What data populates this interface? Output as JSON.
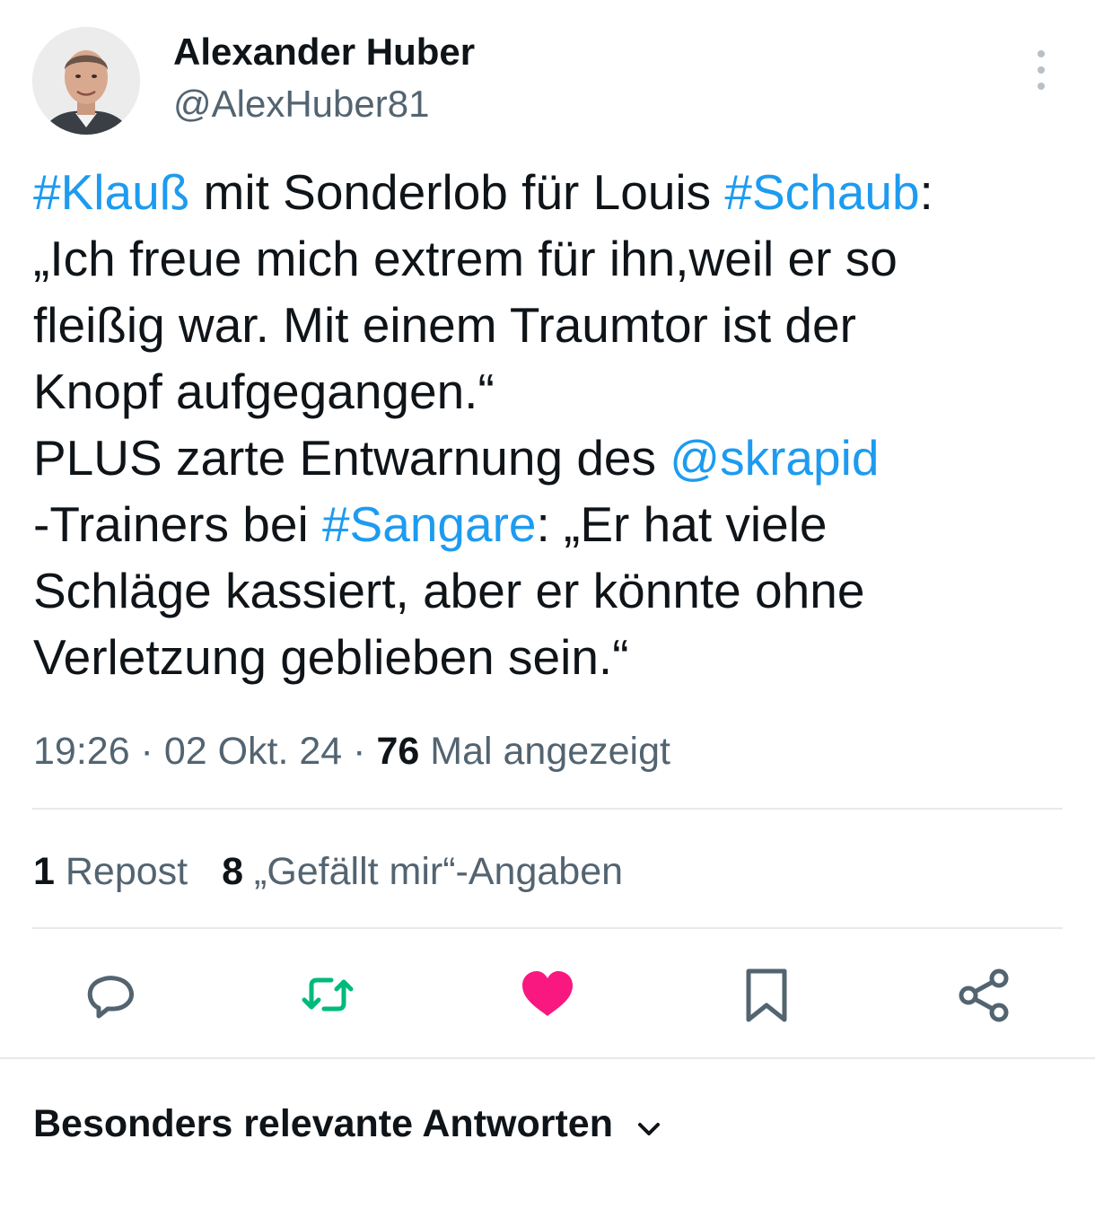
{
  "author": {
    "name": "Alexander Huber",
    "handle": "@AlexHuber81"
  },
  "tweet": {
    "line1": {
      "tag1": "#Klauß",
      "text1": " mit Sonderlob für Louis ",
      "tag2": "#Schaub",
      "text2": ":"
    },
    "line2": "„Ich freue mich extrem für ihn,weil er so",
    "line3": "fleißig war. Mit einem Traumtor ist der",
    "line4": "Knopf aufgegangen.“",
    "line5": {
      "text": "PLUS zarte Entwarnung des ",
      "mention": "@skrapid"
    },
    "line6": {
      "text1": "-Trainers bei ",
      "tag": "#Sangare",
      "text2": ": „Er hat viele"
    },
    "line7": "Schläge kassiert, aber er könnte ohne",
    "line8": "Verletzung geblieben sein.“"
  },
  "meta": {
    "time": "19:26",
    "date": "02 Okt. 24",
    "views_count": "76",
    "views_label": "Mal angezeigt",
    "separator": " · "
  },
  "stats": {
    "reposts_count": "1",
    "reposts_label": "Repost",
    "likes_count": "8",
    "likes_label": "„Gefällt mir“-Angaben"
  },
  "actions": {
    "icons": [
      "reply-icon",
      "repost-icon",
      "like-icon",
      "bookmark-icon",
      "share-icon"
    ],
    "repost_color": "#00ba7c",
    "like_color": "#f91880",
    "icon_color": "#536471"
  },
  "replies_sort": {
    "label": "Besonders relevante Antworten"
  },
  "colors": {
    "link": "#1d9bf0",
    "text": "#0f1419",
    "secondary": "#536471",
    "divider": "#e7e9ea"
  }
}
